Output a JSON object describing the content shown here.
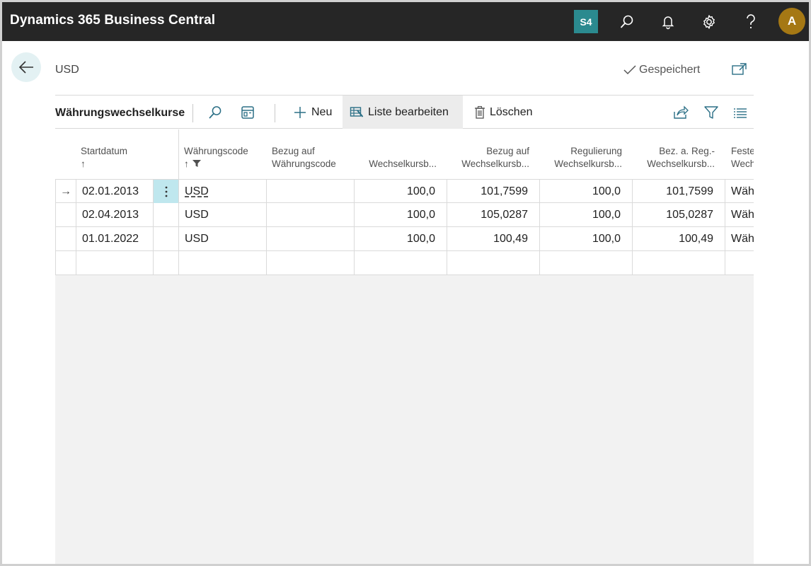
{
  "app": {
    "title": "Dynamics 365 Business Central",
    "company_badge": "S4",
    "avatar_initial": "A"
  },
  "header": {
    "page_title": "USD",
    "saved_label": "Gespeichert"
  },
  "actionbar": {
    "list_title": "Währungswechselkurse",
    "new_label": "Neu",
    "edit_list_label": "Liste bearbeiten",
    "delete_label": "Löschen"
  },
  "grid": {
    "columns": [
      {
        "line1": "Startdatum",
        "line2": "↑"
      },
      {
        "line1": "Währungscode",
        "line2": "↑"
      },
      {
        "line1": "Bezug auf",
        "line2": "Währungscode"
      },
      {
        "line1": "",
        "line2": "Wechselkursb..."
      },
      {
        "line1": "Bezug auf",
        "line2": "Wechselkursb..."
      },
      {
        "line1": "Regulierung",
        "line2": "Wechselkursb..."
      },
      {
        "line1": "Bez. a. Reg.-",
        "line2": "Wechselkursb..."
      },
      {
        "line1": "Feste",
        "line2": "Wech"
      }
    ],
    "rows": [
      {
        "indicator": "→",
        "start": "02.01.2013",
        "code": "USD",
        "relational_code": "",
        "rate": "100,0",
        "rel_rate": "101,7599",
        "adj_rate": "100,0",
        "rel_adj_rate": "101,7599",
        "fixed": "Wäh"
      },
      {
        "indicator": "",
        "start": "02.04.2013",
        "code": "USD",
        "relational_code": "",
        "rate": "100,0",
        "rel_rate": "105,0287",
        "adj_rate": "100,0",
        "rel_adj_rate": "105,0287",
        "fixed": "Wäh"
      },
      {
        "indicator": "",
        "start": "01.01.2022",
        "code": "USD",
        "relational_code": "",
        "rate": "100,0",
        "rel_rate": "100,49",
        "adj_rate": "100,0",
        "rel_adj_rate": "100,49",
        "fixed": "Wäh"
      }
    ]
  },
  "colors": {
    "topbar": "#262626",
    "accent": "#2b8a8f",
    "avatar": "#a57814",
    "selected_cell": "#bfe7ee"
  }
}
